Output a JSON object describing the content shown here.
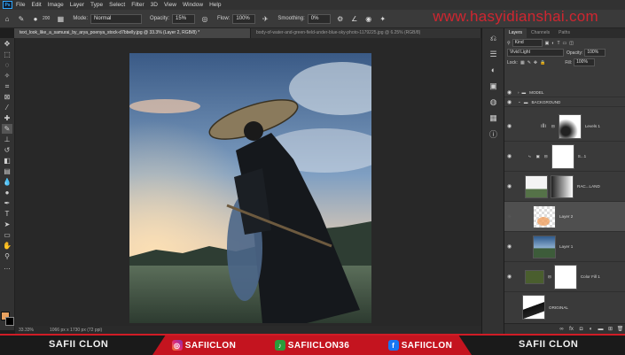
{
  "app": {
    "logo": "Ps"
  },
  "menu": [
    "File",
    "Edit",
    "Image",
    "Layer",
    "Type",
    "Select",
    "Filter",
    "3D",
    "View",
    "Window",
    "Help"
  ],
  "options_bar": {
    "mode_label": "Mode:",
    "mode_value": "Normal",
    "opacity_label": "Opacity:",
    "opacity_value": "15%",
    "flow_label": "Flow:",
    "flow_value": "100%",
    "smoothing_label": "Smoothing:",
    "smoothing_value": "0%",
    "brush_size": "200"
  },
  "watermark": "www.hasyidianshai.com",
  "tabs": [
    {
      "label": "text_look_like_a_samurai_by_arya_poenya_stock-d7bbelly.jpg @ 33.3% (Layer 2, RGB/8) *",
      "active": true
    },
    {
      "label": "body-of-water-and-green-field-under-blue-sky-photo-1179225.jpg @ 6.25% (RGB/8)",
      "active": false
    }
  ],
  "status_bar": {
    "zoom": "33.33%",
    "doc_info": "1066 px x 1730 px (72 ppi)"
  },
  "layers_panel": {
    "tabs": [
      "Layers",
      "Channels",
      "Paths"
    ],
    "filter": "Kind",
    "blend_mode": "Vivid Light",
    "opacity_label": "Opacity:",
    "opacity_value": "100%",
    "lock_label": "Lock:",
    "fill_label": "Fill:",
    "fill_value": "100%",
    "layers": [
      {
        "name": "MODEL",
        "type": "group"
      },
      {
        "name": "BACKGROUND",
        "type": "group"
      },
      {
        "name": "Levels 1",
        "type": "adjustment"
      },
      {
        "name": "S...1",
        "type": "smart"
      },
      {
        "name": "RAC...LAND",
        "type": "image"
      },
      {
        "name": "Layer 2",
        "type": "paint",
        "selected": true
      },
      {
        "name": "Layer 1",
        "type": "image"
      },
      {
        "name": "Color Fill 1",
        "type": "fill"
      },
      {
        "name": "ORIGINAL",
        "type": "image"
      }
    ]
  },
  "banner": {
    "left_name": "SAFII CLON",
    "right_name": "SAFII CLON",
    "instagram": "SAFIICLON",
    "tiktok": "SAFIICLON36",
    "facebook": "SAFIICLON"
  },
  "colors": {
    "accent_red": "#c4141f",
    "fg_swatch": "#e8a15f",
    "bg_swatch": "#000000"
  }
}
